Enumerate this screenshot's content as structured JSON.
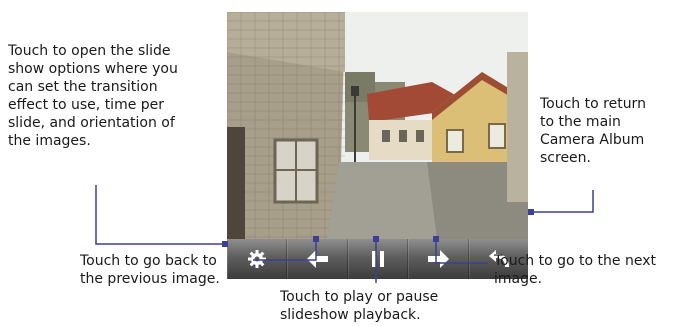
{
  "callouts": {
    "options": [
      "Touch to open the slide",
      "show options where you",
      "can set the transition",
      "effect to use, time per",
      "slide, and orientation of",
      "the images."
    ],
    "return": [
      "Touch to return",
      "to the main",
      "Camera Album",
      "screen."
    ],
    "back": [
      "Touch to go back to",
      "the previous image."
    ],
    "play": [
      "Touch to play or pause",
      "slideshow playback."
    ],
    "next": [
      "Touch to go to the next",
      "image."
    ]
  },
  "toolbar": {
    "buttons": [
      {
        "icon": "gear-icon"
      },
      {
        "icon": "arrow-left-icon"
      },
      {
        "icon": "pause-icon"
      },
      {
        "icon": "arrow-right-icon"
      },
      {
        "icon": "return-icon"
      }
    ]
  },
  "colors": {
    "leader_line": "#3b3f95",
    "toolbar_icon": "#ffffff"
  }
}
